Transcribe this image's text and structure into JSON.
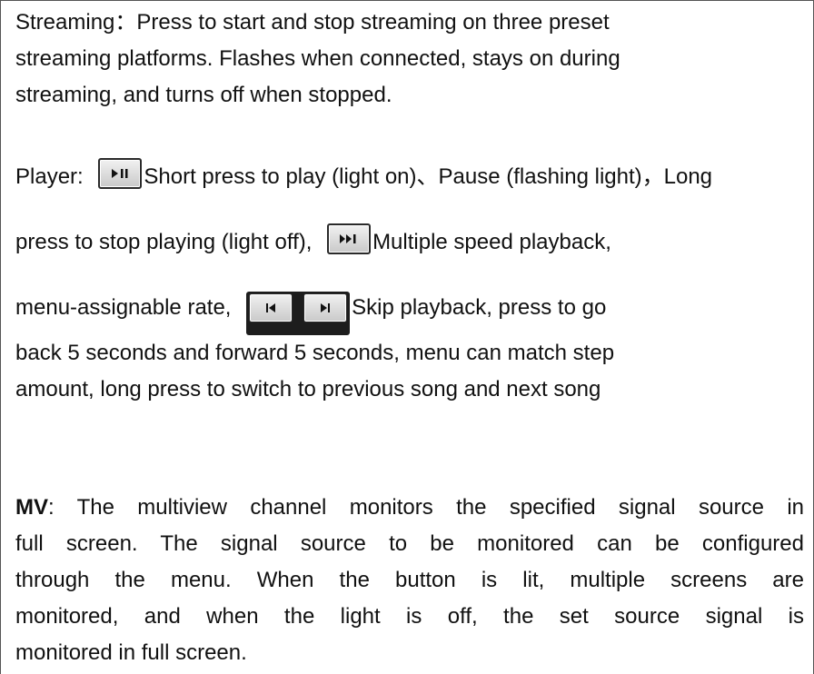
{
  "streaming": {
    "lines": [
      "Streaming：Press to start and stop streaming on three preset",
      "streaming platforms. Flashes when connected, stays on during",
      "streaming, and turns off when stopped."
    ]
  },
  "player": {
    "label": "Player:",
    "play_text": "Short press to play (light on)、Pause (flashing light)，Long",
    "line2_prefix": "press to stop playing (light off),",
    "line2_suffix": "Multiple speed playback,",
    "line3_prefix": "menu-assignable rate,",
    "line3_suffix": "Skip playback, press to go",
    "line4": "back 5 seconds and forward 5 seconds, menu can match step",
    "line5": "amount, long press to switch to previous song and next song",
    "icons": [
      "play-pause-icon",
      "fast-forward-icon",
      "skip-back-icon",
      "skip-forward-icon"
    ]
  },
  "mv": {
    "label": "MV",
    "lines": [
      ": The multiview channel monitors the specified signal source in",
      "full screen. The signal source to be monitored can be configured",
      "through the menu. When the button is lit, multiple screens are",
      "monitored, and when the light is off, the set source signal is",
      "monitored in full screen."
    ]
  }
}
